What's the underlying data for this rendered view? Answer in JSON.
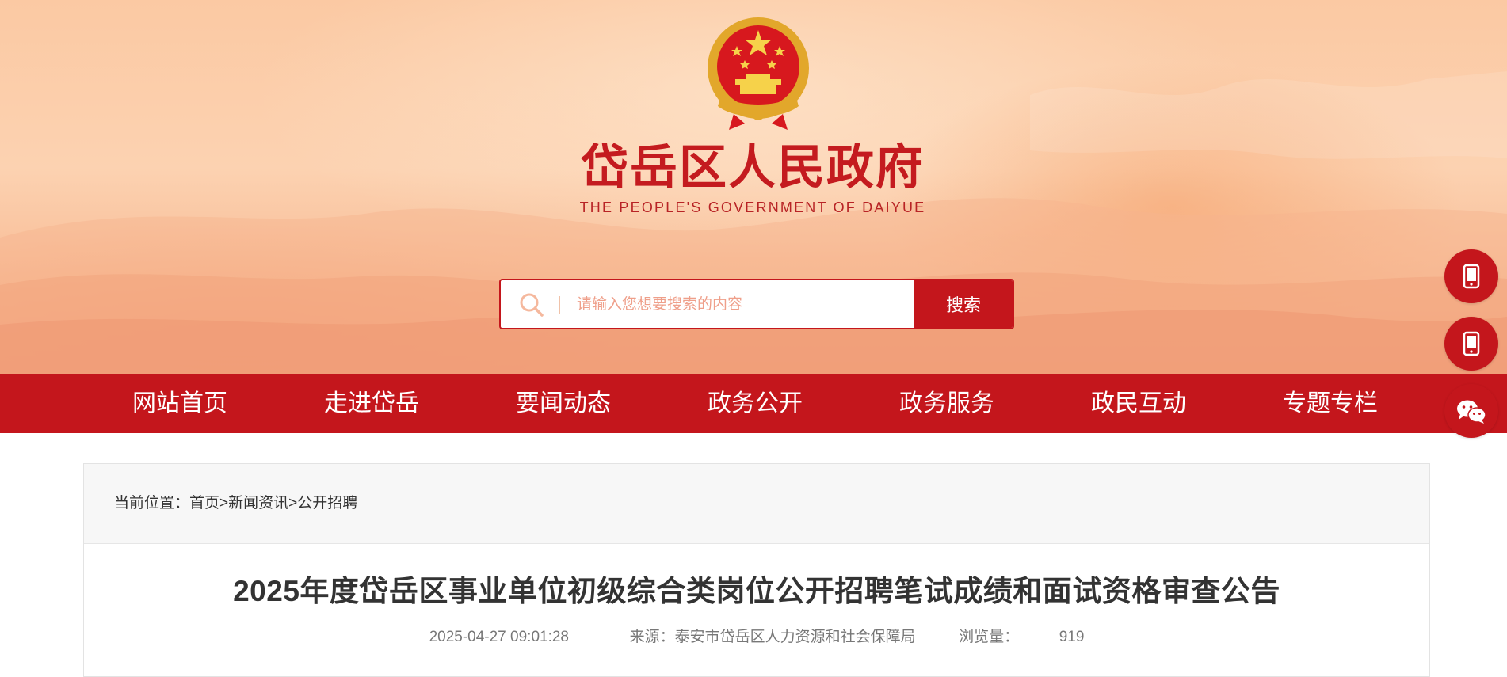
{
  "header": {
    "site_title": "岱岳区人民政府",
    "site_subtitle": "THE PEOPLE'S GOVERNMENT OF DAIYUE",
    "emblem": "national-emblem"
  },
  "search": {
    "placeholder": "请输入您想要搜索的内容",
    "button_label": "搜索",
    "icon": "search-icon"
  },
  "nav": {
    "items": [
      {
        "label": "网站首页"
      },
      {
        "label": "走进岱岳"
      },
      {
        "label": "要闻动态"
      },
      {
        "label": "政务公开"
      },
      {
        "label": "政务服务"
      },
      {
        "label": "政民互动"
      },
      {
        "label": "专题专栏"
      }
    ]
  },
  "floating": {
    "buttons": [
      {
        "icon": "mobile-icon"
      },
      {
        "icon": "tablet-icon"
      },
      {
        "icon": "wechat-icon"
      }
    ]
  },
  "breadcrumb": {
    "prefix": "当前位置：",
    "items": [
      "首页",
      "新闻资讯",
      "公开招聘"
    ],
    "separator": ">"
  },
  "article": {
    "title": "2025年度岱岳区事业单位初级综合类岗位公开招聘笔试成绩和面试资格审查公告",
    "date": "2025-04-27 09:01:28",
    "source_label": "来源：",
    "source": "泰安市岱岳区人力资源和社会保障局",
    "views_label": "浏览量：",
    "views": "919"
  },
  "colors": {
    "brand_red": "#c4161c",
    "banner_peach": "#fcd2b1"
  }
}
